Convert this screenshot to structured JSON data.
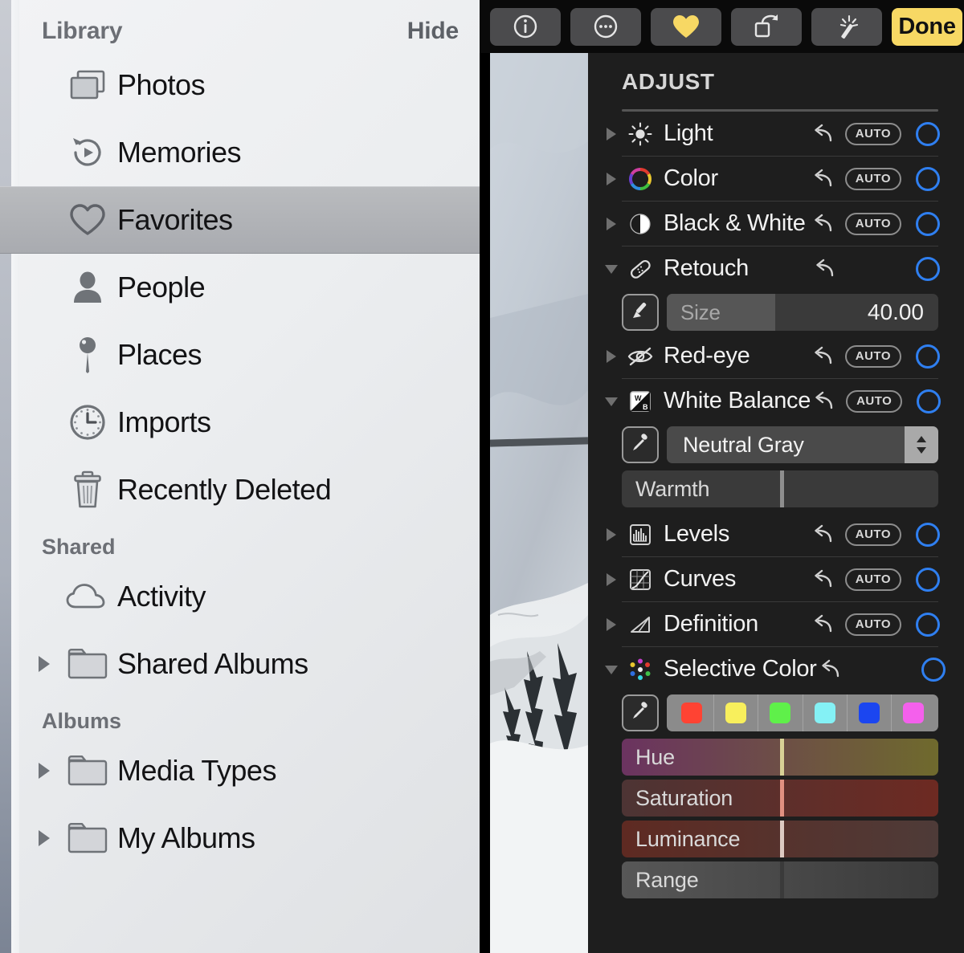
{
  "sidebar": {
    "header": {
      "title": "Library",
      "hide_label": "Hide"
    },
    "library_items": [
      {
        "label": "Photos",
        "icon": "photos-stack-icon",
        "selected": false,
        "disclosure": false
      },
      {
        "label": "Memories",
        "icon": "memories-rewind-icon",
        "selected": false,
        "disclosure": false
      },
      {
        "label": "Favorites",
        "icon": "heart-outline-icon",
        "selected": true,
        "disclosure": false
      },
      {
        "label": "People",
        "icon": "person-silhouette-icon",
        "selected": false,
        "disclosure": false
      },
      {
        "label": "Places",
        "icon": "map-pin-icon",
        "selected": false,
        "disclosure": false
      },
      {
        "label": "Imports",
        "icon": "clock-icon",
        "selected": false,
        "disclosure": false
      },
      {
        "label": "Recently Deleted",
        "icon": "trash-icon",
        "selected": false,
        "disclosure": false
      }
    ],
    "shared_title": "Shared",
    "shared_items": [
      {
        "label": "Activity",
        "icon": "cloud-icon",
        "disclosure": false
      },
      {
        "label": "Shared Albums",
        "icon": "folder-icon",
        "disclosure": true
      }
    ],
    "albums_title": "Albums",
    "albums_items": [
      {
        "label": "Media Types",
        "icon": "folder-icon",
        "disclosure": true
      },
      {
        "label": "My Albums",
        "icon": "folder-icon",
        "disclosure": true
      }
    ]
  },
  "editor": {
    "toolbar": {
      "buttons": [
        {
          "name": "info-icon",
          "label": ""
        },
        {
          "name": "more-ellipsis-icon",
          "label": ""
        },
        {
          "name": "heart-filled-icon",
          "label": ""
        },
        {
          "name": "rotate-icon",
          "label": ""
        },
        {
          "name": "magic-wand-icon",
          "label": ""
        }
      ],
      "done_label": "Done"
    },
    "panel_title": "ADJUST",
    "accent_blue": "#2f7ff0",
    "accent_yellow": "#f7d864",
    "auto_label": "AUTO",
    "adjustments": [
      {
        "label": "Light",
        "icon": "sun-icon",
        "expanded": false,
        "has_auto": true,
        "enabled": false
      },
      {
        "label": "Color",
        "icon": "color-wheel-icon",
        "expanded": false,
        "has_auto": true,
        "enabled": false
      },
      {
        "label": "Black & White",
        "icon": "half-circle-icon",
        "expanded": false,
        "has_auto": true,
        "enabled": false
      },
      {
        "label": "Retouch",
        "icon": "bandage-icon",
        "expanded": true,
        "has_auto": false,
        "enabled": false
      },
      {
        "label": "Red-eye",
        "icon": "eye-slash-icon",
        "expanded": false,
        "has_auto": true,
        "enabled": false
      },
      {
        "label": "White Balance",
        "icon": "wb-square-icon",
        "expanded": true,
        "has_auto": true,
        "enabled": false
      },
      {
        "label": "Levels",
        "icon": "histogram-icon",
        "expanded": false,
        "has_auto": true,
        "enabled": false
      },
      {
        "label": "Curves",
        "icon": "curves-icon",
        "expanded": false,
        "has_auto": true,
        "enabled": false
      },
      {
        "label": "Definition",
        "icon": "definition-triangle-icon",
        "expanded": false,
        "has_auto": true,
        "enabled": false
      },
      {
        "label": "Selective Color",
        "icon": "color-dots-icon",
        "expanded": true,
        "has_auto": false,
        "enabled": false
      }
    ],
    "retouch": {
      "brush_icon": "brush-icon",
      "size_label": "Size",
      "size_value": "40.00",
      "size_percent": 40
    },
    "white_balance": {
      "eyedropper_icon": "eyedropper-icon",
      "mode_value": "Neutral Gray",
      "warmth_label": "Warmth",
      "warmth_percent": 50
    },
    "selective_color": {
      "eyedropper_icon": "eyedropper-icon",
      "swatches": [
        {
          "name": "swatch-red",
          "color": "#ff4333"
        },
        {
          "name": "swatch-yellow",
          "color": "#f8ef5c"
        },
        {
          "name": "swatch-green",
          "color": "#5ff04a"
        },
        {
          "name": "swatch-cyan",
          "color": "#84f1f5"
        },
        {
          "name": "swatch-blue",
          "color": "#1b46f0"
        },
        {
          "name": "swatch-magenta",
          "color": "#f460ec"
        }
      ],
      "sliders": [
        {
          "label": "Hue",
          "percent": 50,
          "left_color": "#6b3360",
          "right_color": "#6f6a2d",
          "mark_color": "#d8d096"
        },
        {
          "label": "Saturation",
          "percent": 50,
          "left_color": "#4d3434",
          "right_color": "#6d2a22",
          "mark_color": "#e09080"
        },
        {
          "label": "Luminance",
          "percent": 50,
          "left_color": "#5e2a22",
          "right_color": "#4e3b38",
          "mark_color": "#ddcac2"
        },
        {
          "label": "Range",
          "percent": 50,
          "left_color": "#575757",
          "right_color": "#3a3a3a",
          "mark_color": "#3a3a3a"
        }
      ]
    },
    "photo": {
      "name": "snow-landscape-photo",
      "description": "Snowy mountain landscape with pine trees under overcast sky"
    }
  }
}
